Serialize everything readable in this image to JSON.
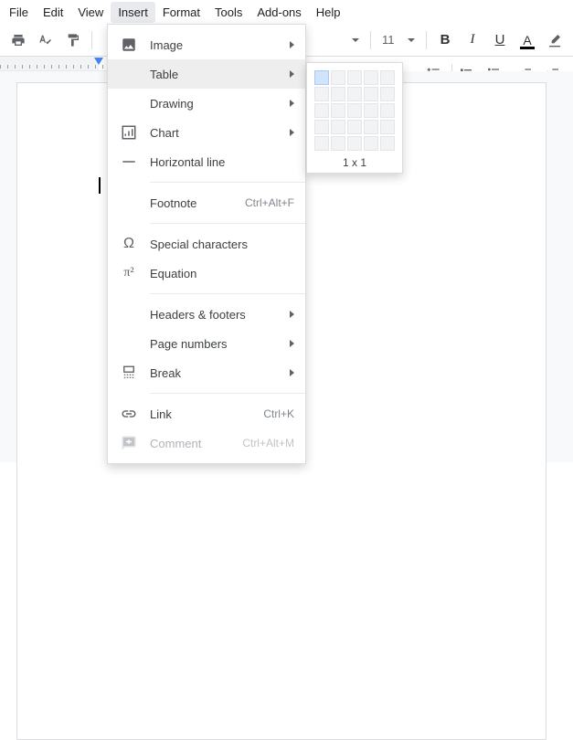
{
  "menubar": {
    "items": [
      {
        "label": "File"
      },
      {
        "label": "Edit"
      },
      {
        "label": "View"
      },
      {
        "label": "Insert"
      },
      {
        "label": "Format"
      },
      {
        "label": "Tools"
      },
      {
        "label": "Add-ons"
      },
      {
        "label": "Help"
      }
    ],
    "active_index": 3
  },
  "toolbar": {
    "font_size": "11"
  },
  "insert_menu": {
    "items": [
      {
        "icon": "image-icon",
        "label": "Image",
        "submenu": true
      },
      {
        "icon": "table-icon",
        "label": "Table",
        "submenu": true,
        "highlight": true
      },
      {
        "icon": "drawing-icon",
        "label": "Drawing",
        "submenu": true
      },
      {
        "icon": "chart-icon",
        "label": "Chart",
        "submenu": true
      },
      {
        "icon": "hr-icon",
        "label": "Horizontal line"
      },
      {
        "sep": true
      },
      {
        "icon": "footnote-icon",
        "label": "Footnote",
        "shortcut": "Ctrl+Alt+F"
      },
      {
        "sep": true
      },
      {
        "icon": "omega-icon",
        "label": "Special characters"
      },
      {
        "icon": "pi-icon",
        "label": "Equation"
      },
      {
        "sep": true
      },
      {
        "icon": "blank-icon",
        "label": "Headers & footers",
        "submenu": true
      },
      {
        "icon": "blank-icon",
        "label": "Page numbers",
        "submenu": true
      },
      {
        "icon": "break-icon",
        "label": "Break",
        "submenu": true
      },
      {
        "sep": true
      },
      {
        "icon": "link-icon",
        "label": "Link",
        "shortcut": "Ctrl+K"
      },
      {
        "icon": "comment-icon",
        "label": "Comment",
        "shortcut": "Ctrl+Alt+M",
        "disabled": true
      }
    ]
  },
  "table_flyout": {
    "rows": 5,
    "cols": 5,
    "sel_rows": 1,
    "sel_cols": 1,
    "label": "1 x 1"
  }
}
